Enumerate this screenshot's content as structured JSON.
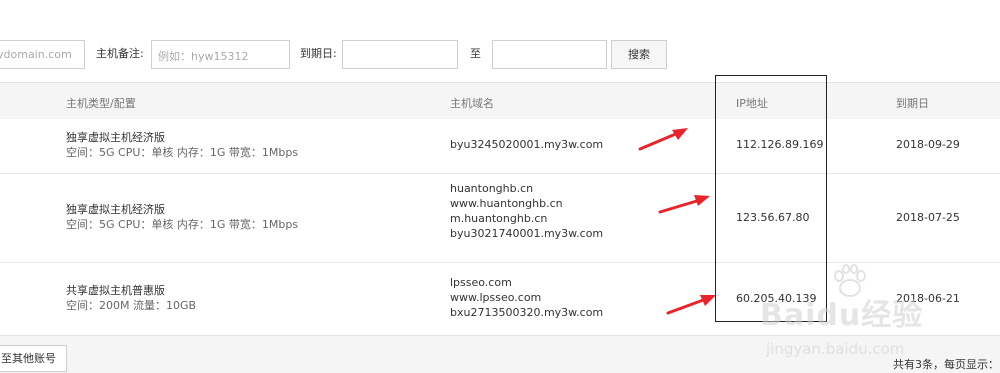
{
  "filter": {
    "domain_placeholder": "ydomain.com",
    "remark_label": "主机备注:",
    "remark_placeholder": "例如：hyw15312",
    "expiry_label": "到期日:",
    "to_label": "至",
    "search_label": "搜索"
  },
  "table": {
    "headers": {
      "type": "主机类型/配置",
      "domain": "主机域名",
      "ip": "IP地址",
      "expiry": "到期日"
    },
    "rows": [
      {
        "type": "独享虚拟主机经济版",
        "config": "空间：5G CPU：单核 内存：1G 带宽：1Mbps",
        "domains": [
          "byu3245020001.my3w.com"
        ],
        "ip": "112.126.89.169",
        "expiry": "2018-09-29"
      },
      {
        "type": "独享虚拟主机经济版",
        "config": "空间：5G CPU：单核 内存：1G 带宽：1Mbps",
        "domains": [
          "huantonghb.cn",
          "www.huantonghb.cn",
          "m.huantonghb.cn",
          "byu3021740001.my3w.com"
        ],
        "ip": "123.56.67.80",
        "expiry": "2018-07-25"
      },
      {
        "type": "共享虚拟主机普惠版",
        "config": "空间：200M 流量：10GB",
        "domains": [
          "lpsseo.com",
          "www.lpsseo.com",
          "bxu2713500320.my3w.com"
        ],
        "ip": "60.205.40.139",
        "expiry": "2018-06-21"
      }
    ]
  },
  "footer": {
    "switch_label": "至其他账号",
    "pager_text": "共有3条，每页显示："
  },
  "watermark": {
    "brand": "Baidu经验",
    "url": "jingyan.baidu.com"
  },
  "colors": {
    "arrow": "#e8242a",
    "header_bg": "#f5f5f5",
    "border": "#e3e3e3"
  }
}
